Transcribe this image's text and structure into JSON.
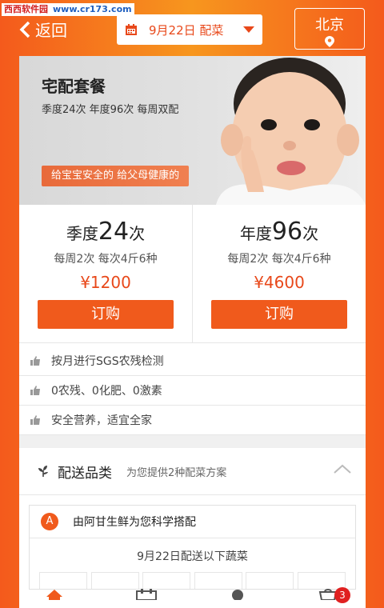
{
  "watermark": {
    "site_cn": "西西软件园",
    "site_url": "www.cr173.com"
  },
  "header": {
    "back_label": "返回",
    "date_value": "9月22日 配菜",
    "city": "北京"
  },
  "banner": {
    "title": "宅配套餐",
    "subtitle": "季度24次 年度96次 每周双配",
    "slogan": "给宝宝安全的  给父母健康的"
  },
  "plans": [
    {
      "prefix": "季度",
      "count": "24",
      "suffix": "次",
      "desc": "每周2次 每次4斤6种",
      "price": "¥1200",
      "buy_label": "订购"
    },
    {
      "prefix": "年度",
      "count": "96",
      "suffix": "次",
      "desc": "每周2次 每次4斤6种",
      "price": "¥4600",
      "buy_label": "订购"
    }
  ],
  "features": [
    "按月进行SGS农残检测",
    "0农残、0化肥、0激素",
    "安全营养，适宜全家"
  ],
  "category": {
    "title": "配送品类",
    "subtitle": "为您提供2种配菜方案"
  },
  "plan_card": {
    "badge": "A",
    "title": "由阿甘生鲜为您科学搭配",
    "date_line": "9月22日配送以下蔬菜"
  },
  "tabbar": {
    "cart_count": "3"
  },
  "colors": {
    "accent": "#f05a1c",
    "price": "#e8481a"
  }
}
